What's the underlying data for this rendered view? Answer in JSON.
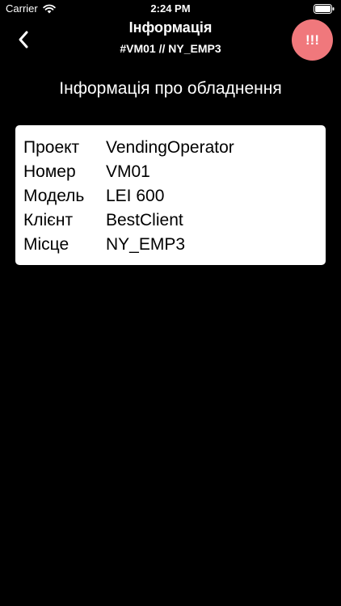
{
  "status_bar": {
    "carrier": "Carrier",
    "time": "2:24 PM"
  },
  "nav": {
    "title": "Інформація",
    "subtitle": "#VM01 // NY_EMP3",
    "alert_label": "!!!",
    "alert_color": "#f0787c"
  },
  "main": {
    "heading": "Інформація про обладнення",
    "info": [
      {
        "label": "Проект",
        "value": "VendingOperator"
      },
      {
        "label": "Номер",
        "value": "VM01"
      },
      {
        "label": "Модель",
        "value": "LEI 600"
      },
      {
        "label": "Клієнт",
        "value": "BestClient"
      },
      {
        "label": "Місце",
        "value": "NY_EMP3"
      }
    ]
  },
  "icons": {
    "back": "chevron-left-icon",
    "wifi": "wifi-icon",
    "battery": "battery-icon"
  }
}
